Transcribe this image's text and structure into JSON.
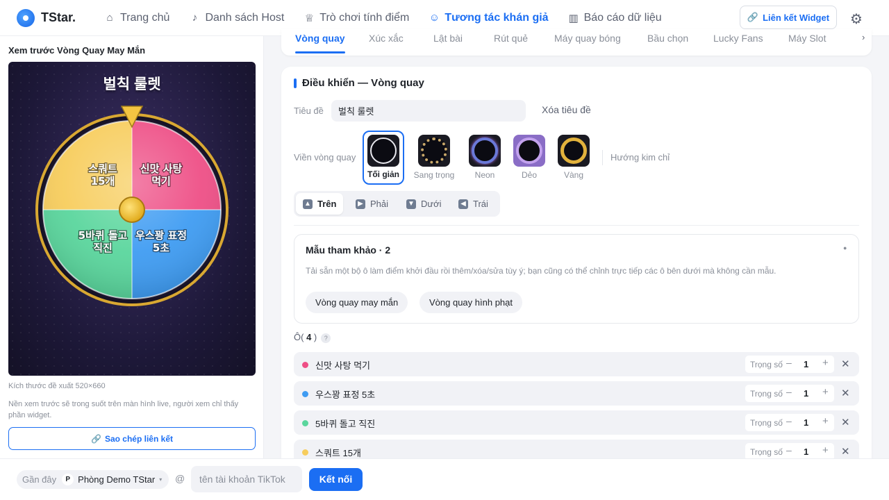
{
  "app": {
    "name": "TStar."
  },
  "nav": [
    {
      "label": "Trang chủ",
      "icon": "home-icon",
      "glyph": "⌂"
    },
    {
      "label": "Danh sách Host",
      "icon": "microphone-icon",
      "glyph": "🎙"
    },
    {
      "label": "Trò chơi tính điểm",
      "icon": "trophy-icon",
      "glyph": "🏆"
    },
    {
      "label": "Tương tác khán giả",
      "icon": "users-icon",
      "glyph": "👥",
      "active": true
    },
    {
      "label": "Báo cáo dữ liệu",
      "icon": "bar-chart-icon",
      "glyph": "📊"
    }
  ],
  "header": {
    "widget_link_label": "Liên kết Widget"
  },
  "preview": {
    "title": "Xem trước Vòng Quay May Mắn",
    "wheel_title": "벌칙 룰렛",
    "segments": [
      {
        "label": "신맛 사탕 먹기",
        "color": "#ee4f86"
      },
      {
        "label": "우스꽝 표정 5초",
        "color": "#3f9cf2"
      },
      {
        "label": "5바퀴 돌고 직진",
        "color": "#5ad69d"
      },
      {
        "label": "스쿼트 15개",
        "color": "#f7cd5d"
      }
    ],
    "export_size": "Kích thước đề xuất 520×660",
    "note": "Nền xem trước sẽ trong suốt trên màn hình live, người xem chỉ thấy phần widget.",
    "copy_link_label": "Sao chép liên kết"
  },
  "game_tabs": [
    "Vòng quay",
    "Xúc xắc",
    "Lật bài",
    "Rút quẻ",
    "Máy quay bóng",
    "Bầu chọn",
    "Lucky Fans",
    "Máy Slot"
  ],
  "control": {
    "heading": "Điều khiển — Vòng quay",
    "title_label": "Tiêu đề",
    "title_value": "벌칙 룰렛",
    "clear_title_label": "Xóa tiêu đề",
    "frame_label": "Viền vòng quay",
    "frames": [
      {
        "label": "Tối giản",
        "selected": true,
        "ring": "#e8e8ee"
      },
      {
        "label": "Sang trọng",
        "ring": "#c9a86a"
      },
      {
        "label": "Neon",
        "ring": "#6a79d8"
      },
      {
        "label": "Dẻo",
        "ring": "#c3a2ee"
      },
      {
        "label": "Vàng",
        "ring": "#e2b23c"
      }
    ],
    "pointer_label": "Hướng kim chỉ",
    "directions": [
      {
        "label": "Trên",
        "glyph": "⬆",
        "active": true
      },
      {
        "label": "Phải",
        "glyph": "➡"
      },
      {
        "label": "Dưới",
        "glyph": "⬇"
      },
      {
        "label": "Trái",
        "glyph": "⬅"
      }
    ]
  },
  "templates": {
    "title": "Mẫu tham khảo · 2",
    "description": "Tải sẵn một bộ ô làm điểm khởi đầu rồi thêm/xóa/sửa tùy ý; bạn cũng có thể chỉnh trực tiếp các ô bên dưới mà không cần mẫu.",
    "items": [
      "Vòng quay may mắn",
      "Vòng quay hình phạt"
    ]
  },
  "cells": {
    "label": "Ô",
    "count": "4",
    "help": "?",
    "weight_label": "Trọng số",
    "rows": [
      {
        "name": "신맛 사탕 먹기",
        "color": "#ee4f86",
        "weight": "1"
      },
      {
        "name": "우스꽝 표정 5초",
        "color": "#3f9cf2",
        "weight": "1"
      },
      {
        "name": "5바퀴 돌고 직진",
        "color": "#5ad69d",
        "weight": "1"
      },
      {
        "name": "스쿼트 15개",
        "color": "#f7cd5d",
        "weight": "1"
      }
    ]
  },
  "bottom": {
    "recent_label": "Gần đây",
    "room_badge": "P",
    "room_name": "Phòng Demo TStar",
    "at": "@",
    "tiktok_placeholder": "tên tài khoản TikTok",
    "connect_label": "Kết nối"
  }
}
